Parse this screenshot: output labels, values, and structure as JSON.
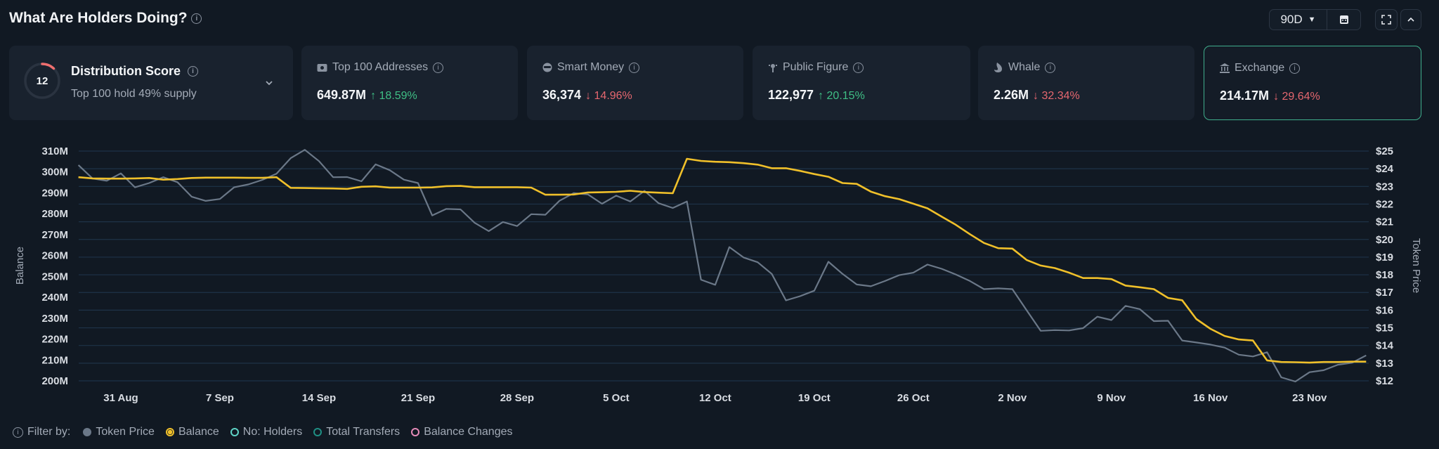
{
  "header": {
    "title": "What Are Holders Doing?",
    "range": "90D"
  },
  "distribution": {
    "score": "12",
    "score_fraction": 0.12,
    "title": "Distribution Score",
    "subtitle": "Top 100 hold 49% supply"
  },
  "cards": [
    {
      "label": "Top 100 Addresses",
      "icon": "wallet-icon",
      "value": "649.87M",
      "change": "18.59%",
      "dir": "up",
      "arrow": "↑"
    },
    {
      "label": "Smart Money",
      "icon": "sunglasses-face-icon",
      "value": "36,374",
      "change": "14.96%",
      "dir": "down",
      "arrow": "↓"
    },
    {
      "label": "Public Figure",
      "icon": "public-figure-icon",
      "value": "122,977",
      "change": "20.15%",
      "dir": "up",
      "arrow": "↑"
    },
    {
      "label": "Whale",
      "icon": "whale-icon",
      "value": "2.26M",
      "change": "32.34%",
      "dir": "down",
      "arrow": "↓"
    },
    {
      "label": "Exchange",
      "icon": "bank-icon",
      "value": "214.17M",
      "change": "29.64%",
      "dir": "down",
      "arrow": "↓"
    }
  ],
  "legend": {
    "filter_label": "Filter by:",
    "items": [
      {
        "label": "Token Price",
        "color": "#6b7888",
        "state": "filled"
      },
      {
        "label": "Balance",
        "color": "#f0c02a",
        "state": "selected"
      },
      {
        "label": "No: Holders",
        "color": "#5fd3c6",
        "state": "off"
      },
      {
        "label": "Total Transfers",
        "color": "#1f8f84",
        "state": "off"
      },
      {
        "label": "Balance Changes",
        "color": "#e58bb8",
        "state": "off"
      }
    ]
  },
  "chart_data": {
    "type": "line",
    "ylabel": "Balance",
    "y2label": "Token Price",
    "ylim": [
      200,
      310
    ],
    "y2lim": [
      12,
      25
    ],
    "yticks": [
      "310M",
      "300M",
      "290M",
      "280M",
      "270M",
      "260M",
      "250M",
      "240M",
      "230M",
      "220M",
      "210M",
      "200M"
    ],
    "y2ticks": [
      "$25",
      "$24",
      "$23",
      "$22",
      "$21",
      "$20",
      "$19",
      "$18",
      "$17",
      "$16",
      "$15",
      "$14",
      "$13",
      "$12"
    ],
    "x_unit": "days since 31 Aug",
    "x_start_day": -3,
    "xticks": [
      {
        "label": "31 Aug",
        "day": 0
      },
      {
        "label": "7 Sep",
        "day": 7
      },
      {
        "label": "14 Sep",
        "day": 14
      },
      {
        "label": "21 Sep",
        "day": 21
      },
      {
        "label": "28 Sep",
        "day": 28
      },
      {
        "label": "5 Oct",
        "day": 35
      },
      {
        "label": "12 Oct",
        "day": 42
      },
      {
        "label": "19 Oct",
        "day": 49
      },
      {
        "label": "26 Oct",
        "day": 56
      },
      {
        "label": "2 Nov",
        "day": 63
      },
      {
        "label": "9 Nov",
        "day": 70
      },
      {
        "label": "16 Nov",
        "day": 77
      },
      {
        "label": "23 Nov",
        "day": 84
      }
    ],
    "series": [
      {
        "name": "Balance",
        "axis": "left",
        "unit": "M",
        "color": "#f0c02a",
        "values": [
          297.5,
          296.9,
          296.8,
          296.8,
          296.9,
          297.1,
          296.3,
          296.6,
          297.1,
          297.3,
          297.3,
          297.3,
          297.2,
          297.2,
          297.5,
          292.4,
          292.3,
          292.2,
          292.1,
          291.9,
          292.9,
          293.1,
          292.5,
          292.5,
          292.5,
          292.6,
          293.2,
          293.3,
          292.7,
          292.7,
          292.7,
          292.7,
          292.5,
          289.1,
          289.1,
          289.2,
          290.2,
          290.3,
          290.5,
          291.0,
          290.4,
          290.1,
          289.8,
          306.3,
          305.3,
          304.9,
          304.7,
          304.2,
          303.5,
          301.8,
          301.8,
          300.5,
          299.0,
          297.7,
          294.7,
          294.3,
          290.6,
          288.4,
          287.0,
          284.8,
          282.6,
          278.6,
          274.7,
          270.2,
          266.0,
          263.5,
          263.3,
          257.9,
          255.2,
          254.0,
          251.8,
          249.2,
          249.2,
          248.7,
          245.6,
          244.8,
          243.9,
          239.7,
          238.6,
          229.6,
          224.9,
          221.5,
          219.8,
          219.3,
          209.8,
          209.0,
          208.9,
          208.7,
          209.0,
          209.0,
          209.2,
          209.2
        ]
      },
      {
        "name": "Token Price",
        "axis": "right",
        "unit": "$",
        "color": "#6b7888",
        "values": [
          24.21,
          23.45,
          23.32,
          23.74,
          22.95,
          23.19,
          23.52,
          23.24,
          22.42,
          22.18,
          22.29,
          22.95,
          23.11,
          23.37,
          23.72,
          24.6,
          25.07,
          24.43,
          23.52,
          23.53,
          23.29,
          24.25,
          23.92,
          23.38,
          23.19,
          21.36,
          21.73,
          21.7,
          20.94,
          20.47,
          20.99,
          20.76,
          21.43,
          21.4,
          22.19,
          22.62,
          22.55,
          22.02,
          22.48,
          22.15,
          22.75,
          22.05,
          21.78,
          22.15,
          17.72,
          17.43,
          19.57,
          18.98,
          18.71,
          18.05,
          16.55,
          16.79,
          17.1,
          18.74,
          18.05,
          17.45,
          17.35,
          17.65,
          17.98,
          18.12,
          18.58,
          18.34,
          18.02,
          17.65,
          17.19,
          17.23,
          17.19,
          16.0,
          14.83,
          14.87,
          14.85,
          14.98,
          15.63,
          15.44,
          16.24,
          16.06,
          15.38,
          15.4,
          14.28,
          14.17,
          14.05,
          13.88,
          13.48,
          13.38,
          13.62,
          12.2,
          11.96,
          12.49,
          12.6,
          12.91,
          13.02,
          13.44
        ]
      }
    ]
  }
}
